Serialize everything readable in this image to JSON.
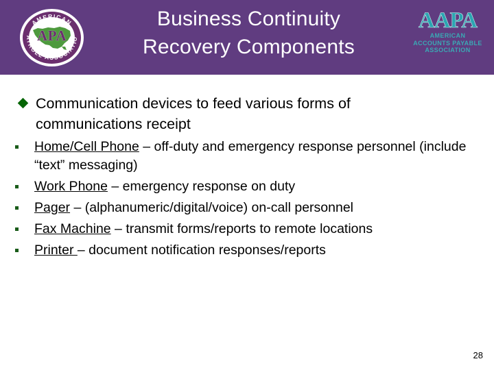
{
  "slide": {
    "page_number": "28",
    "colors": {
      "header_purple": "#603C80",
      "bullet_green": "#046504",
      "subbullet_green": "#1A5C1A",
      "aapa_teal": "#2BA6B2",
      "apa_purple": "#6B2F6E",
      "title_text": "#FFFFFF",
      "body_text": "#000000",
      "background": "#FFFFFF"
    }
  },
  "header": {
    "title_line1": "Business Continuity",
    "title_line2": "Recovery Components",
    "apa_logo": {
      "center": "APA",
      "arc_top": "AMERICAN",
      "arc_bottom": "PAYROLL ASSOCIATION"
    },
    "aapa_logo": {
      "wordmark": "AAPA",
      "sub_line1": "AMERICAN",
      "sub_line2": "ACCOUNTS PAYABLE",
      "sub_line3": "ASSOCIATION"
    }
  },
  "body": {
    "main_bullet": {
      "marker": "diamond",
      "text": "Communication devices to feed various forms of communications receipt"
    },
    "sub_bullets": [
      {
        "term": "Home/Cell Phone",
        "rest": " – off-duty and emergency response personnel (include “text” messaging)"
      },
      {
        "term": "Work Phone",
        "rest": " – emergency response on duty"
      },
      {
        "term": "Pager",
        "rest": " – (alphanumeric/digital/voice) on-call personnel"
      },
      {
        "term": "Fax Machine",
        "rest": " – transmit forms/reports to remote locations"
      },
      {
        "term": "Printer ",
        "rest": "– document notification responses/reports"
      }
    ]
  }
}
